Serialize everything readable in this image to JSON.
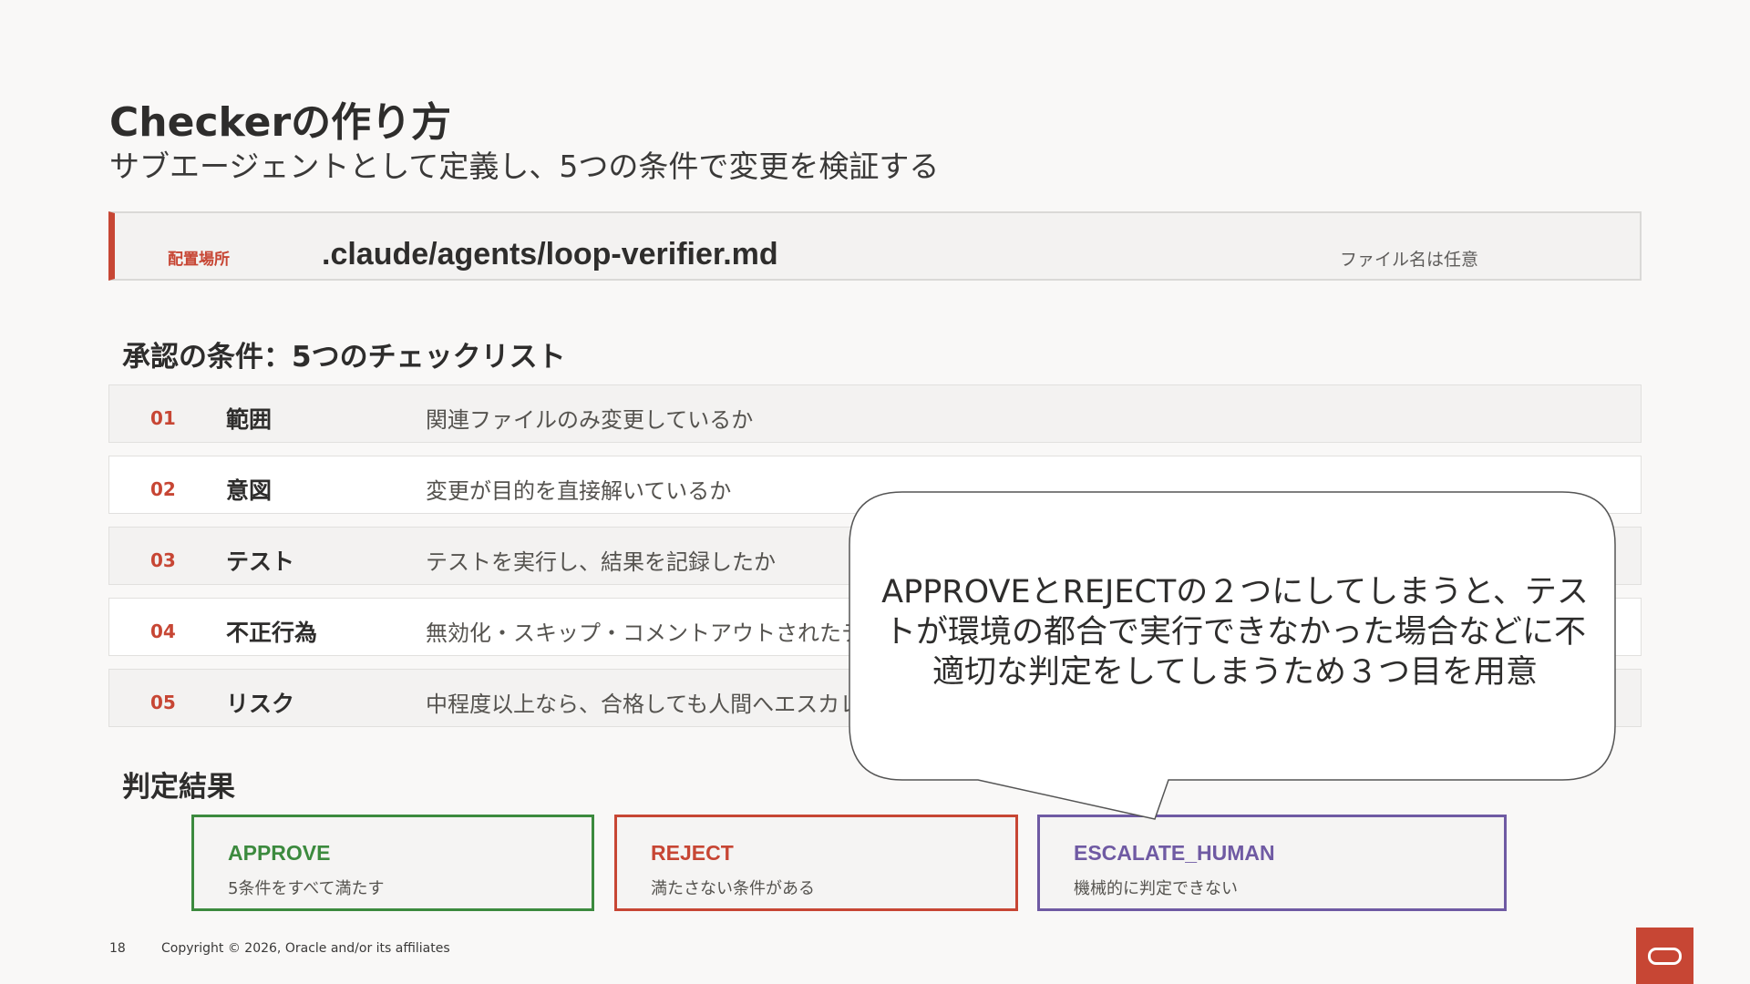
{
  "slide": {
    "title": "Checkerの作り方",
    "subtitle": "サブエージェントとして定義し、5つの条件で変更を検証する"
  },
  "location": {
    "label": "配置場所",
    "path": ".claude/agents/loop-verifier.md",
    "note": "ファイル名は任意"
  },
  "checklist": {
    "heading": "承認の条件：5つのチェックリスト",
    "items": [
      {
        "num": "01",
        "name": "範囲",
        "desc": "関連ファイルのみ変更しているか"
      },
      {
        "num": "02",
        "name": "意図",
        "desc": "変更が目的を直接解いているか"
      },
      {
        "num": "03",
        "name": "テスト",
        "desc": "テストを実行し、結果を記録したか"
      },
      {
        "num": "04",
        "name": "不正行為",
        "desc": "無効化・スキップ・コメントアウトされたテ"
      },
      {
        "num": "05",
        "name": "リスク",
        "desc": "中程度以上なら、合格しても人間へエスカレ"
      }
    ]
  },
  "results": {
    "heading": "判定結果",
    "items": [
      {
        "code": "APPROVE",
        "desc": "5条件をすべて満たす",
        "color": "#3c8a3e"
      },
      {
        "code": "REJECT",
        "desc": "満たさない条件がある",
        "color": "#c74634"
      },
      {
        "code": "ESCALATE_HUMAN",
        "desc": "機械的に判定できない",
        "color": "#6f5aa3"
      }
    ]
  },
  "callout": {
    "text": "APPROVEとREJECTの２つにしてしまうと、テストが環境の都合で実行できなかった場合などに不適切な判定をしてしまうため３つ目を用意"
  },
  "footer": {
    "page": "18",
    "copyright": "Copyright © 2026, Oracle and/or its affiliates"
  },
  "colors": {
    "accent": "#c74634",
    "approve": "#3c8a3e",
    "reject": "#c74634",
    "escalate": "#6f5aa3"
  },
  "icons": {
    "logo": "oracle-logo-icon"
  }
}
